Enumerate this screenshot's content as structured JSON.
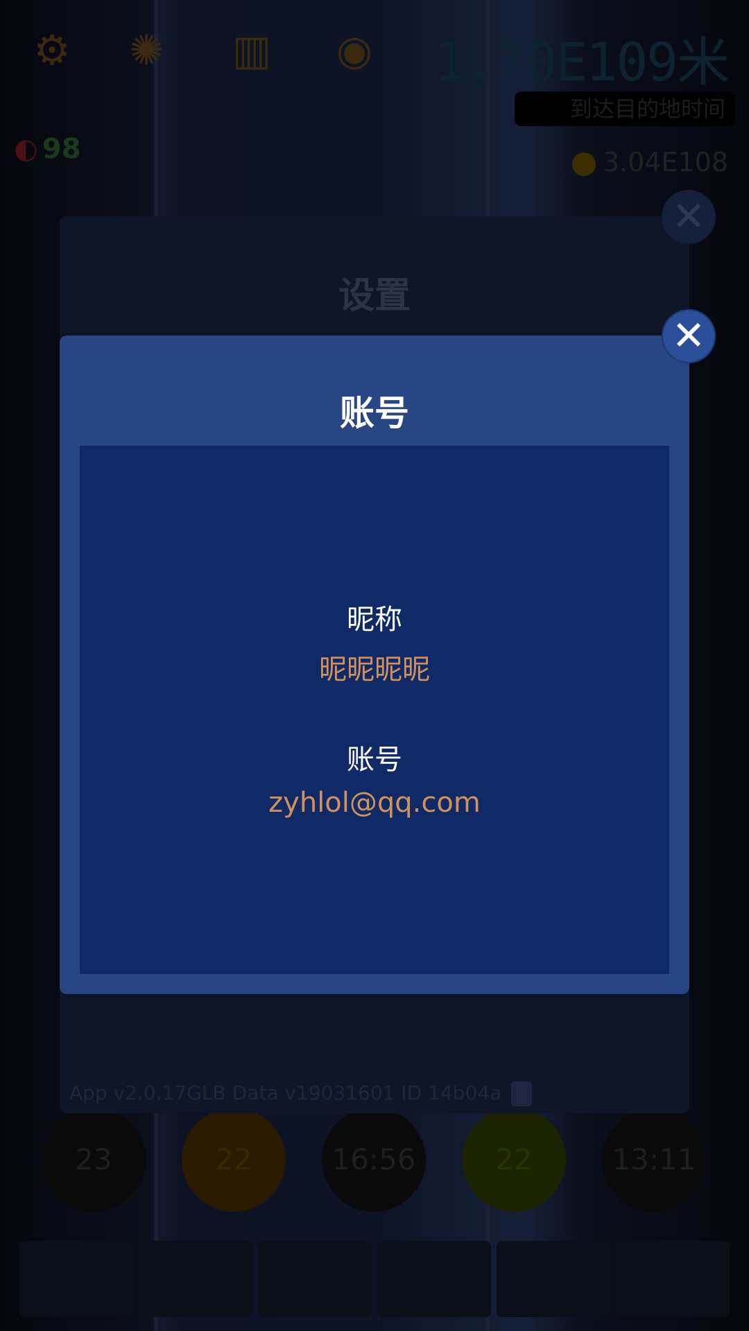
{
  "game_hud": {
    "distance": "1.70E109米",
    "banner": "到达目的地时间",
    "planet_count": "98",
    "coins": "3.04E108",
    "bottom_circles": [
      "23",
      "22",
      "16:56",
      "22",
      "13:11"
    ]
  },
  "settings_panel": {
    "title": "设置",
    "footer": "App v2.0.17GLB  Data v19031601  ID 14b04a"
  },
  "account_dialog": {
    "title": "账号",
    "nickname_label": "昵称",
    "nickname_value": "昵昵昵昵",
    "account_label": "账号",
    "account_value": "zyhlol@qq.com"
  },
  "icons": {
    "close": "close-icon",
    "user": "user-icon",
    "music": "music-icon",
    "copy": "copy-icon"
  },
  "colors": {
    "dialog_bg": "#284684",
    "dialog_body": "#0f2a66",
    "value_text": "#d1915c",
    "close_button": "#2b4f9a"
  }
}
